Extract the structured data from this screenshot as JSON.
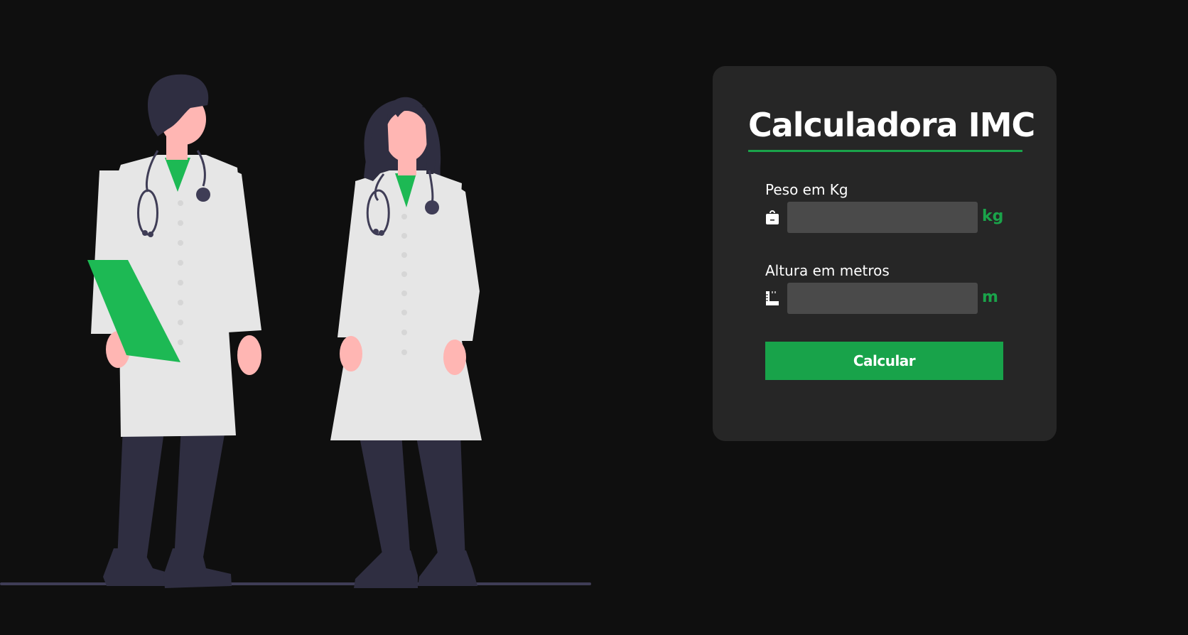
{
  "card": {
    "title": "Calculadora IMC",
    "weight": {
      "label": "Peso em Kg",
      "value": "",
      "unit": "kg",
      "icon": "weight-icon"
    },
    "height": {
      "label": "Altura em metros",
      "value": "",
      "unit": "m",
      "icon": "ruler-icon"
    },
    "button_label": "Calcular"
  },
  "colors": {
    "background": "#0f0f0f",
    "card": "#262626",
    "accent": "#1aa34a",
    "input": "#4a4a4a",
    "coat": "#e6e6e6",
    "skin": "#ffb6b3",
    "dark": "#2f2e41"
  }
}
